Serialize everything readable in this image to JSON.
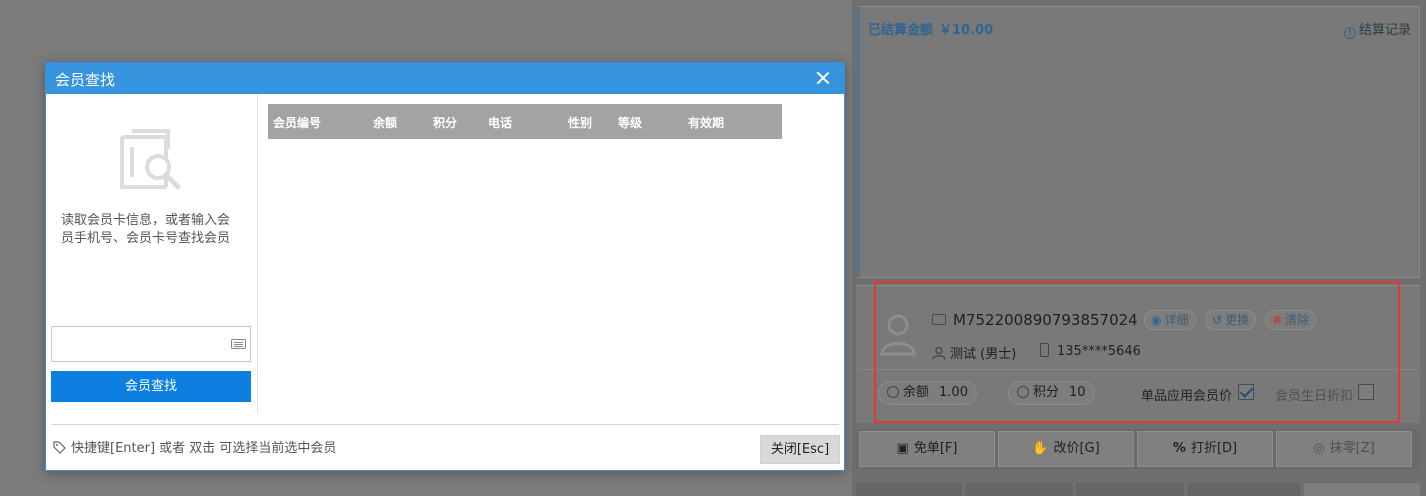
{
  "dialog": {
    "title": "会员查找",
    "hint": "读取会员卡信息，或者输入会员手机号、会员卡号查找会员",
    "search_input_value": "",
    "search_button": "会员查找",
    "columns": [
      "会员编号",
      "余额",
      "积分",
      "电话",
      "性别",
      "等级",
      "有效期"
    ],
    "footer_hint": "快捷键[Enter] 或者 双击 可选择当前选中会员",
    "close_button": "关闭[Esc]"
  },
  "background": {
    "settled_label": "已结算金额",
    "settled_amount": "￥10.00",
    "settle_record": "结算记录",
    "member": {
      "number": "M752200890793857024",
      "detail_button": "详细",
      "change_button": "更换",
      "clear_button": "清除",
      "name": "测试 (男士)",
      "phone": "135****5646",
      "balance_label": "余额",
      "balance_value": "1.00",
      "points_label": "积分",
      "points_value": "10",
      "member_price_label": "单品应用会员价",
      "member_price_checked": true,
      "birthday_discount_label": "会员生日折扣",
      "birthday_discount_checked": false
    },
    "actions": [
      {
        "label": "免单[F]",
        "icon": "gift-icon"
      },
      {
        "label": "改价[G]",
        "icon": "hand-coin-icon"
      },
      {
        "label": "打折[D]",
        "icon": "percent-icon"
      },
      {
        "label": "抹零[Z]",
        "icon": "coin-icon"
      }
    ]
  },
  "colors": {
    "dialog_header": "#3694de",
    "primary_button": "#0c7fe0",
    "highlight_frame": "#e23a2e",
    "table_header": "#a3a3a3"
  }
}
